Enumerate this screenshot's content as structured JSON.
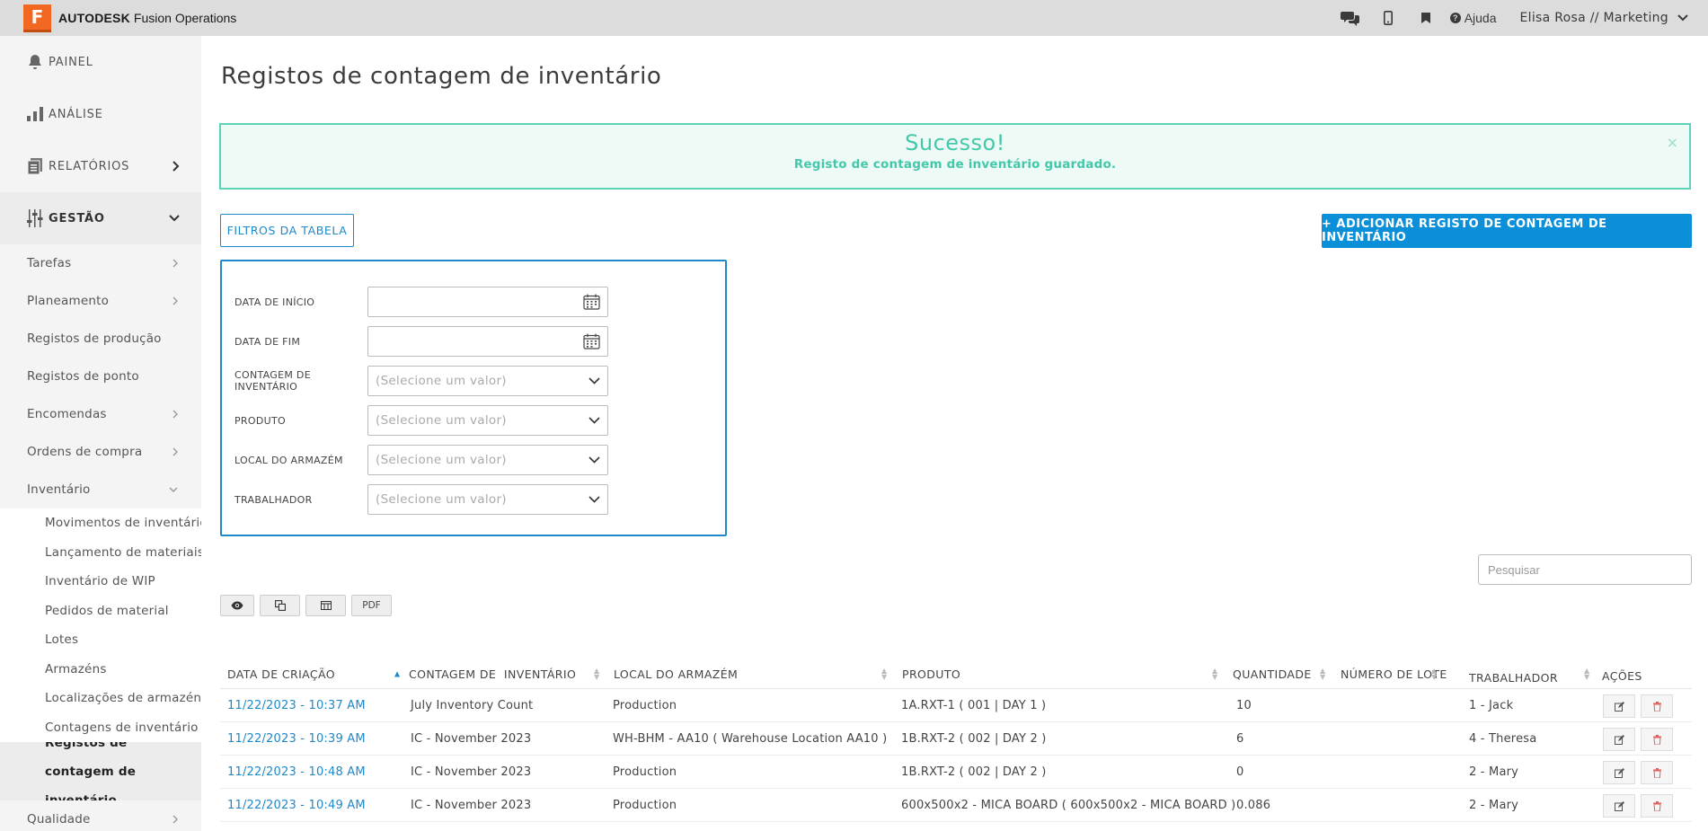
{
  "topbar": {
    "logo_letter": "F",
    "brand": "AUTODESK",
    "product": "Fusion Operations",
    "help_label": "Ajuda",
    "user_label": "Elisa Rosa // Marketing"
  },
  "sidebar": {
    "main": [
      {
        "label": "PAINEL",
        "icon": "bell-icon"
      },
      {
        "label": "ANÁLISE",
        "icon": "bar-chart-icon"
      },
      {
        "label": "RELATÓRIOS",
        "icon": "report-icon"
      },
      {
        "label": "GESTÃO",
        "icon": "sliders-icon"
      }
    ],
    "sub": [
      {
        "label": "Tarefas"
      },
      {
        "label": "Planeamento"
      },
      {
        "label": "Registos de produção"
      },
      {
        "label": "Registos de ponto"
      },
      {
        "label": "Encomendas"
      },
      {
        "label": "Ordens de compra"
      },
      {
        "label": "Inventário"
      }
    ],
    "inventory_items": [
      {
        "label": "Movimentos de inventário"
      },
      {
        "label": "Lançamento de materiais"
      },
      {
        "label": "Inventário de WIP"
      },
      {
        "label": "Pedidos de material"
      },
      {
        "label": "Lotes"
      },
      {
        "label": "Armazéns"
      },
      {
        "label": "Localizações de armazéns"
      },
      {
        "label": "Contagens de inventário"
      },
      {
        "label": "Registos de contagem de inventário"
      }
    ],
    "after": [
      {
        "label": "Qualidade"
      }
    ]
  },
  "main": {
    "title": "Registos de contagem de inventário",
    "alert": {
      "title": "Sucesso!",
      "message": "Registo de contagem de inventário guardado.",
      "close": "×"
    },
    "filter_button": "FILTROS DA TABELA",
    "add_button": "+ ADICIONAR REGISTO DE CONTAGEM DE INVENTÁRIO",
    "filters": [
      {
        "label": "DATA DE INÍCIO",
        "value": "",
        "kind": "date"
      },
      {
        "label": "DATA DE FIM",
        "value": "",
        "kind": "date"
      },
      {
        "label": "CONTAGEM DE INVENTÁRIO",
        "value": "(Selecione um valor)",
        "kind": "select"
      },
      {
        "label": "PRODUTO",
        "value": "(Selecione um valor)",
        "kind": "select"
      },
      {
        "label": "LOCAL DO ARMAZÉM",
        "value": "(Selecione um valor)",
        "kind": "select"
      },
      {
        "label": "TRABALHADOR",
        "value": "(Selecione um valor)",
        "kind": "select"
      }
    ],
    "search_placeholder": "Pesquisar",
    "toolbar": {
      "view_icon": "eye-icon",
      "copy_icon": "copy-icon",
      "columns_icon": "columns-icon",
      "pdf_label": "PDF"
    },
    "table": {
      "headers": [
        "DATA DE CRIAÇÃO",
        "CONTAGEM DE  INVENTÁRIO",
        "LOCAL DO ARMAZÉM",
        "PRODUTO",
        "QUANTIDADE",
        "NÚMERO DE LOTE",
        "TRABALHADOR",
        "AÇÕES"
      ],
      "rows": [
        [
          "11/22/2023 - 10:37 AM",
          "July Inventory Count",
          "Production",
          "1A.RXT-1 ( 001 | DAY 1 )",
          "10",
          "",
          "1 - Jack"
        ],
        [
          "11/22/2023 - 10:39 AM",
          "IC - November 2023",
          "WH-BHM - AA10 ( Warehouse Location AA10 )",
          "1B.RXT-2 ( 002 | DAY 2 )",
          "6",
          "",
          "4 - Theresa"
        ],
        [
          "11/22/2023 - 10:48 AM",
          "IC - November 2023",
          "Production",
          "1B.RXT-2 ( 002 | DAY 2 )",
          "0",
          "",
          "2 - Mary"
        ],
        [
          "11/22/2023 - 10:49 AM",
          "IC - November 2023",
          "Production",
          "600x500x2 - MICA BOARD ( 600x500x2 - MICA BOARD )",
          "0.086",
          "",
          "2 - Mary"
        ]
      ]
    }
  }
}
